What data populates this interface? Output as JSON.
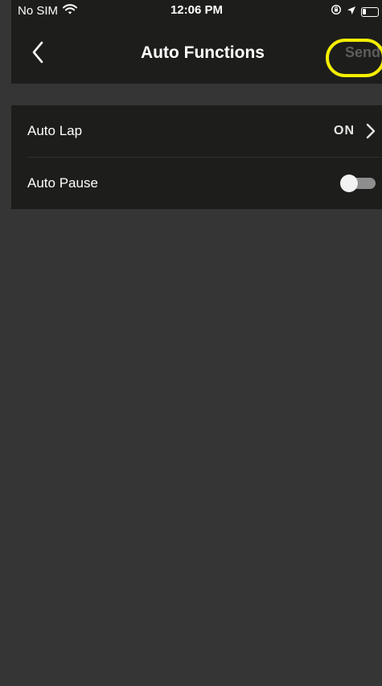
{
  "status_bar": {
    "carrier": "No SIM",
    "time": "12:06 PM",
    "wifi_icon": "wifi-icon",
    "orientation_lock_icon": "orientation-lock-icon",
    "location_icon": "location-arrow-icon",
    "battery_icon": "battery-icon"
  },
  "nav": {
    "title": "Auto Functions",
    "send_label": "Send",
    "back_icon": "chevron-left-icon"
  },
  "settings": [
    {
      "label": "Auto Lap",
      "value": "ON",
      "chevron_icon": "chevron-right-icon"
    },
    {
      "label": "Auto Pause",
      "toggle_on": false
    }
  ],
  "colors": {
    "background": "#353535",
    "bar_background": "#1d1e1b",
    "send_disabled": "#5d5d5d",
    "highlight_annotation": "#f4ee00"
  }
}
